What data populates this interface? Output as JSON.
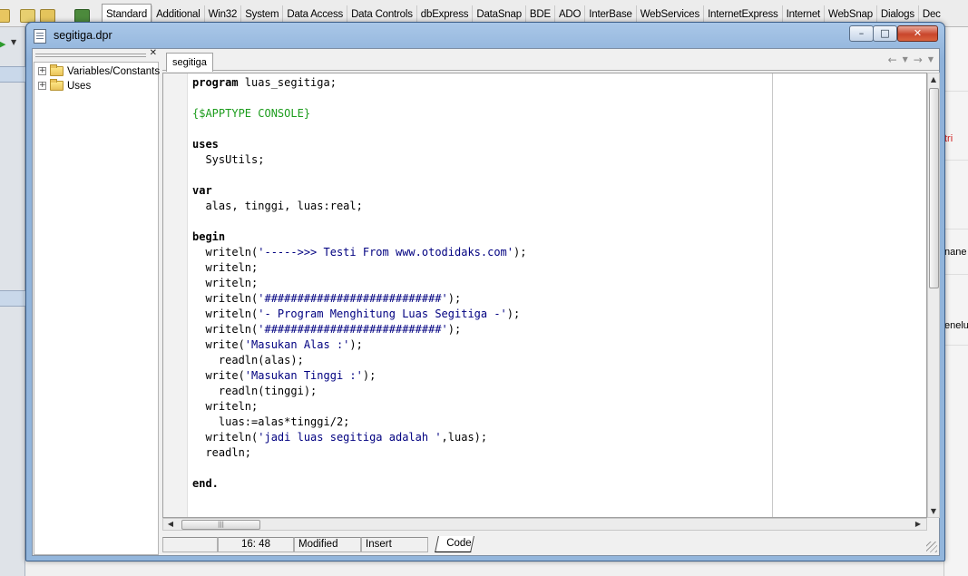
{
  "palette": {
    "tabs": [
      "Standard",
      "Additional",
      "Win32",
      "System",
      "Data Access",
      "Data Controls",
      "dbExpress",
      "DataSnap",
      "BDE",
      "ADO",
      "InterBase",
      "WebServices",
      "InternetExpress",
      "Internet",
      "WebSnap",
      "Dialogs",
      "Dec"
    ],
    "selected": "Standard"
  },
  "background": {
    "right_fragments": [
      "tri",
      "nane",
      "enelu"
    ]
  },
  "window": {
    "title": "segitiga.dpr",
    "buttons": {
      "minimize": "–",
      "maximize": "□",
      "close": "✕"
    }
  },
  "explorer": {
    "close_label": "✕",
    "items": [
      {
        "label": "Variables/Constants",
        "expander": "+"
      },
      {
        "label": "Uses",
        "expander": "+"
      }
    ]
  },
  "editor": {
    "tab": "segitiga",
    "lines": [
      "program luas_segitiga;",
      "",
      "{$APPTYPE CONSOLE}",
      "",
      "uses",
      "  SysUtils;",
      "",
      "var",
      "  alas, tinggi, luas:real;",
      "",
      "begin",
      "  writeln('----->>> Testi From www.otodidaks.com');",
      "  writeln;",
      "  writeln;",
      "  writeln('###########################');",
      "  writeln('- Program Menghitung Luas Segitiga -');",
      "  writeln('###########################');",
      "  write('Masukan Alas :');",
      "    readln(alas);",
      "  write('Masukan Tinggi :');",
      "    readln(tinggi);",
      "  writeln;",
      "    luas:=alas*tinggi/2;",
      "  writeln('jadi luas segitiga adalah ',luas);",
      "  readln;",
      "",
      "end."
    ]
  },
  "statusbar": {
    "position": "16:  48",
    "modified": "Modified",
    "mode": "Insert",
    "view_tab": "Code"
  },
  "colors": {
    "keyword": "#000000",
    "string": "#000080",
    "directive": "#1c9c1c"
  }
}
